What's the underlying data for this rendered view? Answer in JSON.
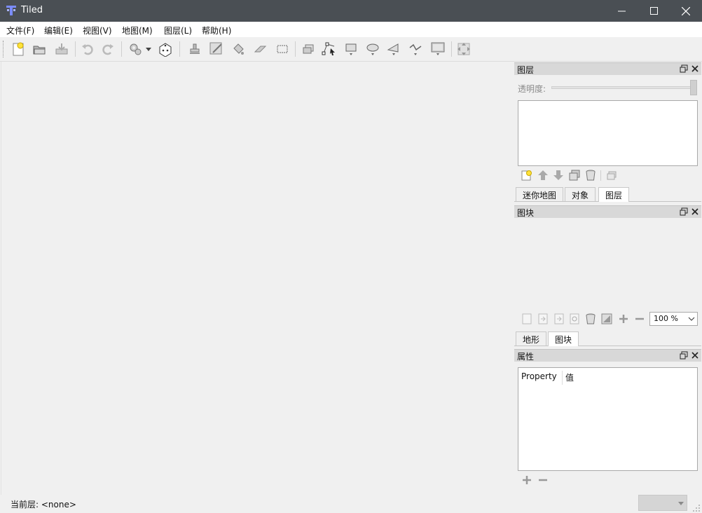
{
  "window": {
    "title": "Tiled"
  },
  "menu": [
    "文件(F)",
    "编辑(E)",
    "视图(V)",
    "地图(M)",
    "图层(L)",
    "帮助(H)"
  ],
  "layers_panel": {
    "title": "图层",
    "opacity_label": "透明度:"
  },
  "tabs_top": [
    "迷你地图",
    "对象",
    "图层"
  ],
  "tileset_panel": {
    "title": "图块",
    "zoom_value": "100 %"
  },
  "tabs_mid": [
    "地形",
    "图块"
  ],
  "properties_panel": {
    "title": "属性",
    "col_property": "Property",
    "col_value": "值"
  },
  "status": {
    "current_layer": "当前层: <none>"
  },
  "colors": {
    "titlebar": "#4a4f54",
    "menubar": "#ffffff",
    "background": "#f0f0f0",
    "dock_title": "#d8d8d8"
  }
}
